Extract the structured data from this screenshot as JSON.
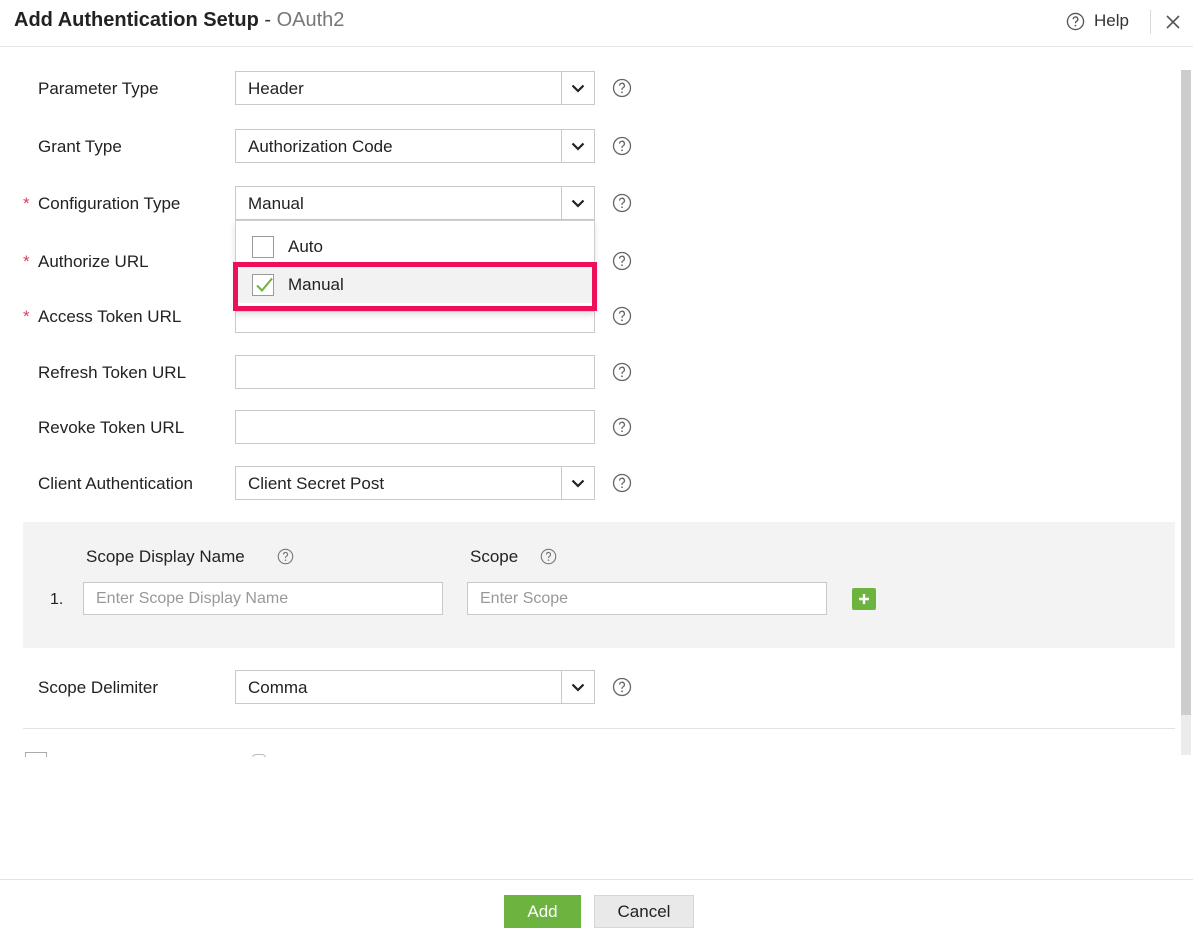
{
  "header": {
    "title": "Add Authentication Setup",
    "separator": " - ",
    "subtitle": "OAuth2",
    "help_label": "Help"
  },
  "form": {
    "parameter_type": {
      "label": "Parameter Type",
      "value": "Header"
    },
    "grant_type": {
      "label": "Grant Type",
      "value": "Authorization Code"
    },
    "configuration_type": {
      "label": "Configuration Type",
      "value": "Manual",
      "required_mark": "*",
      "options": [
        "Auto",
        "Manual"
      ],
      "selected": "Manual"
    },
    "authorize_url": {
      "label": "Authorize URL",
      "value": "",
      "required_mark": "*"
    },
    "access_token_url": {
      "label": "Access Token URL",
      "value": "",
      "required_mark": "*"
    },
    "refresh_token_url": {
      "label": "Refresh Token URL",
      "value": ""
    },
    "revoke_token_url": {
      "label": "Revoke Token URL",
      "value": ""
    },
    "client_authentication": {
      "label": "Client Authentication",
      "value": "Client Secret Post"
    },
    "scope_delimiter": {
      "label": "Scope Delimiter",
      "value": "Comma"
    }
  },
  "scopes": {
    "display_name_header": "Scope Display Name",
    "scope_header": "Scope",
    "rows": [
      {
        "index": "1.",
        "display_name_placeholder": "Enter Scope Display Name",
        "scope_placeholder": "Enter Scope"
      }
    ]
  },
  "footer": {
    "add_label": "Add",
    "cancel_label": "Cancel"
  },
  "colors": {
    "accent_green": "#6db33f",
    "highlight": "#ee0f5a",
    "required": "#d9435e",
    "check": "#6db33f"
  }
}
